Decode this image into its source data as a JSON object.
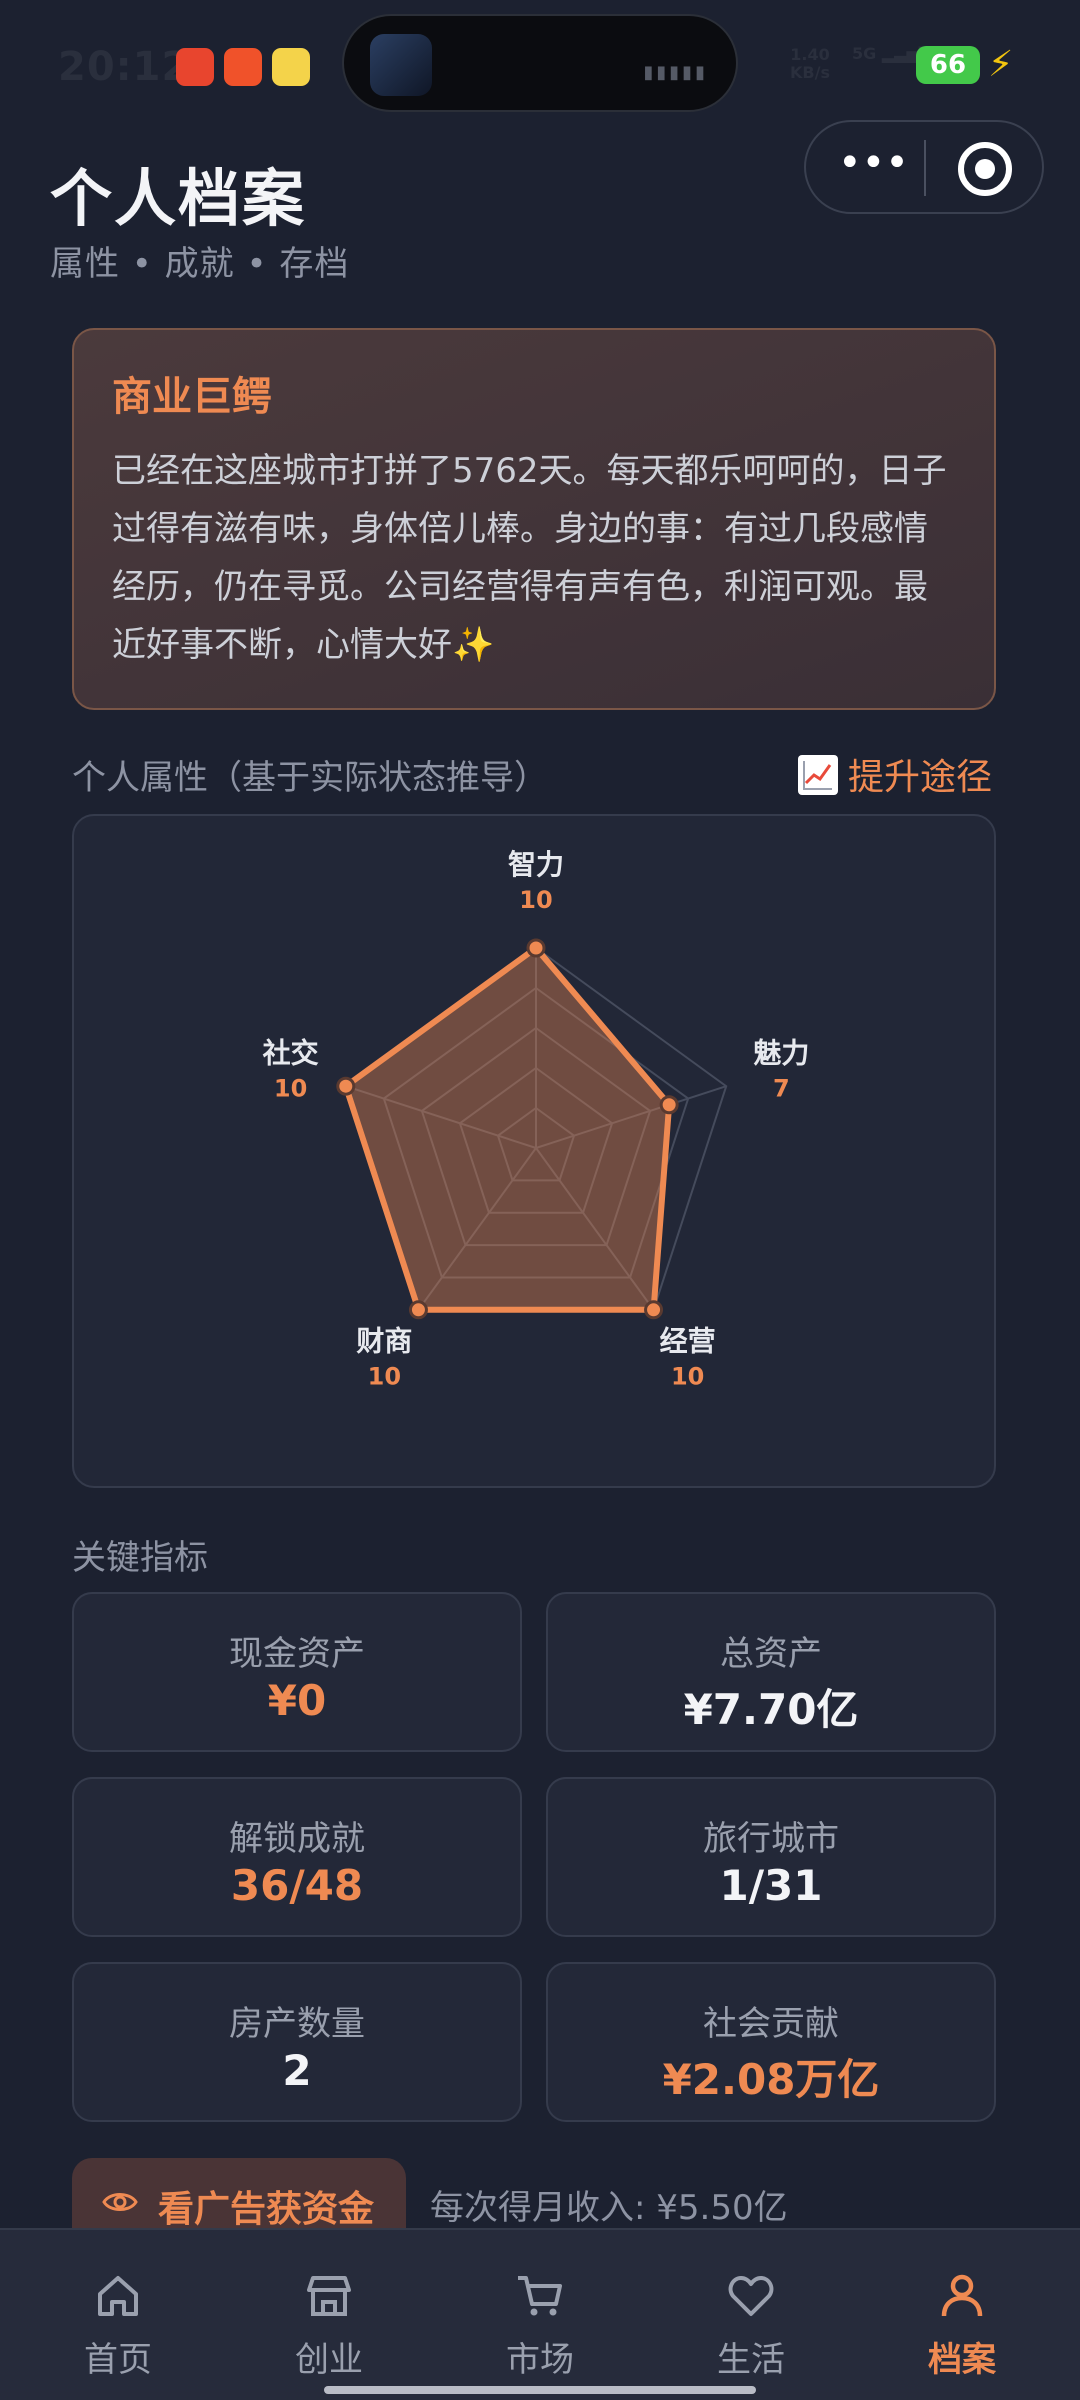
{
  "status_bar": {
    "time": "20:12",
    "net_speed_value": "1.40",
    "net_speed_unit": "KB/s",
    "network": "5G",
    "battery": "66"
  },
  "header": {
    "title": "个人档案",
    "subtitle": "属性 • 成就 • 存档"
  },
  "intro": {
    "title": "商业巨鳄",
    "text": "已经在这座城市打拼了5762天。每天都乐呵呵的，日子过得有滋有味，身体倍儿棒。身边的事：有过几段感情经历，仍在寻觅。公司经营得有声有色，利润可观。最近好事不断，心情大好✨"
  },
  "attributes": {
    "section_label": "个人属性（基于实际状态推导）",
    "boost_link": "提升途径",
    "max_value": 10,
    "items": [
      {
        "name": "智力",
        "value": 10
      },
      {
        "name": "魅力",
        "value": 7
      },
      {
        "name": "经营",
        "value": 10
      },
      {
        "name": "财商",
        "value": 10
      },
      {
        "name": "社交",
        "value": 10
      }
    ],
    "colors": {
      "accent": "#ef8a52",
      "grid": "#454b5c"
    }
  },
  "metrics": {
    "section_label": "关键指标",
    "items": [
      {
        "label": "现金资产",
        "value": "¥0",
        "tone": "orange"
      },
      {
        "label": "总资产",
        "value": "¥7.70亿",
        "tone": "white"
      },
      {
        "label": "解锁成就",
        "value": "36/48",
        "tone": "orange"
      },
      {
        "label": "旅行城市",
        "value": "1/31",
        "tone": "white"
      },
      {
        "label": "房产数量",
        "value": "2",
        "tone": "white"
      },
      {
        "label": "社会贡献",
        "value": "¥2.08万亿",
        "tone": "orange"
      }
    ]
  },
  "ad": {
    "button_label": "看广告获资金",
    "note": "每次得月收入: ¥5.50亿",
    "icon": "eye-icon"
  },
  "tabbar": {
    "tabs": [
      {
        "label": "首页",
        "icon": "home-icon"
      },
      {
        "label": "创业",
        "icon": "store-icon"
      },
      {
        "label": "市场",
        "icon": "cart-icon"
      },
      {
        "label": "生活",
        "icon": "heart-icon"
      },
      {
        "label": "档案",
        "icon": "person-icon",
        "active": true
      }
    ]
  }
}
